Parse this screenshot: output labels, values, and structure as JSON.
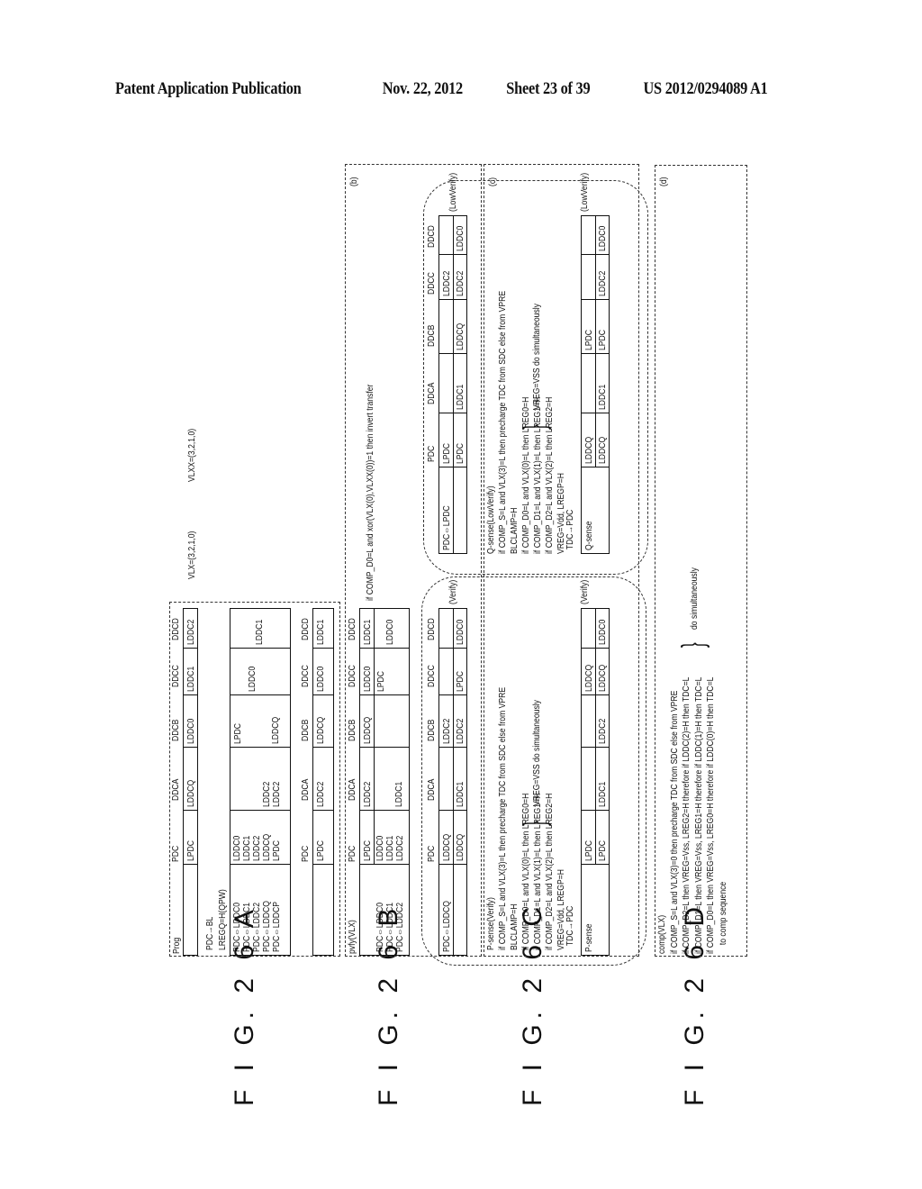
{
  "header": {
    "publication": "Patent Application Publication",
    "date": "Nov. 22, 2012",
    "sheet": "Sheet 23 of 39",
    "number": "US 2012/0294089 A1"
  },
  "figures": {
    "a": {
      "label": "F I G. 2 6 A",
      "vlx": "VLX=(3,2,1,0)",
      "vlxx": "VLXX=(3,2,1,0)",
      "columns": [
        "PDC",
        "DDCA",
        "DDCB",
        "DDCC",
        "DDCD"
      ],
      "table1": {
        "title": "Prog",
        "row": [
          "LPDC",
          "LDDCQ",
          "LDDC0",
          "LDDC1",
          "LDDC2"
        ]
      },
      "line1": "PDC→BL",
      "line2": "LREGQ=H(QPW)",
      "table2": {
        "ops": [
          "PDC⇔LDDC0",
          "PDC⇔LDDC1",
          "PDC⇔LDDC2",
          "PDC⇔LDDCQ",
          "PDC⇔LDDCP"
        ],
        "pdc": [
          "LDDC0",
          "LDDC1",
          "LDDC2",
          "LDDCQ",
          "LPDC"
        ],
        "ddca": [
          "LDDC2",
          "LDDC2"
        ],
        "ddcb_top": "LPDC",
        "ddcb_bottom": "LDDCQ",
        "ddcc": "LDDC0",
        "ddcd": "LDDC1"
      },
      "table3": {
        "row": [
          "LPDC",
          "LDDC2",
          "LDDCQ",
          "LDDC0",
          "LDDC1"
        ]
      }
    },
    "b": {
      "label": "F I G. 2 6 B",
      "tag": "(b)",
      "title": "pvfy(VLX)",
      "columns": [
        "PDC",
        "DDCA",
        "DDCB",
        "DDCC",
        "DDCD"
      ],
      "table1": {
        "header_row": [
          "LPDC",
          "LDDC2",
          "LDDCQ",
          "LDDC0",
          "LDDC1"
        ],
        "ops": [
          "PDC⇔LDDC0",
          "PDC⇔LDDC1",
          "PDC⇔LDDC2"
        ],
        "pdc": [
          "LDDC0",
          "LDDC1",
          "LDDC2"
        ],
        "ddca": "LDDC1",
        "ddcc": "LPDC",
        "ddcd": "LDDC0"
      },
      "condition": "if COMP_D0=L and xor(VLX(0),VLXX(0))=1 then invert transfer",
      "verify": {
        "op": "PDC⇔LDDCQ",
        "row1": [
          "LDDCQ",
          "",
          "LDDC2",
          "",
          ""
        ],
        "row2": [
          "LDDCQ",
          "LDDC1",
          "LDDC2",
          "LPDC",
          "LDDC0"
        ],
        "note": "(Verify)"
      },
      "lowverify": {
        "op": "PDC⇔LPDC",
        "row1": [
          "LPDC",
          "",
          "",
          "LDDC2",
          ""
        ],
        "row2": [
          "LPDC",
          "LDDC1",
          "LDDCQ",
          "LDDC2",
          "LDDC0"
        ],
        "note": "(LowVerify)"
      }
    },
    "c": {
      "label": "F I G. 2 6 C",
      "tag": "(c)",
      "psense": {
        "title": "P-sense(Verify)",
        "lines": [
          "if  COMP_S=L and VLX(3)=L then precharge TDC from SDC else from VPRE",
          "BLCLAMP=H",
          "if  COMP_D0=L and VLX(0)=L then LREG0=H",
          "if  COMP_D1=L and VLX(1)=L then LREG1=H",
          "if  COMP_D2=L and VLX(2)=L then LREG2=H",
          "VREG=Vdd, LREGP=H",
          "TDC→PDC"
        ],
        "brace_text": "VREG=VSS do simultaneously",
        "table_label": "P-sense",
        "row1": [
          "LPDC",
          "",
          "",
          "LDDCQ",
          ""
        ],
        "row2": [
          "LPDC",
          "LDDC1",
          "LDDC2",
          "LDDCQ",
          "LDDC0"
        ],
        "note": "(Verify)"
      },
      "qsense": {
        "title": "Q-sense(LowVerify)",
        "lines": [
          "if  COMP_S=L and VLX(3)=L then precharge TDC from SDC else from VPRE",
          "BLCLAMP=H",
          "if  COMP_D0=L and VLX(0)=L then LREG0=H",
          "if  COMP_D1=L and VLX(1)=L then LREG1=H",
          "if  COMP_D2=L and VLX(2)=L then LREG2=H",
          "VREG=Vdd, LREGP=H",
          "TDC→PDC"
        ],
        "brace_text": "VREG=VSS do simultaneously",
        "table_label": "Q-sense",
        "row1": [
          "LDDCQ",
          "",
          "LPDC",
          "",
          ""
        ],
        "row2": [
          "LDDCQ",
          "LDDC1",
          "LPDC",
          "LDDC2",
          "LDDC0"
        ],
        "note": "(LowVerify)"
      }
    },
    "d": {
      "label": "F I G. 2 6 D",
      "tag": "(d)",
      "title": "comp(VLX)",
      "lines": [
        "if  COMP_S=L and VLX(3)=0 then precharge TDC from SDC else from VPRE",
        "if  COMP_D2=L then VREG=Vss, LREG2=H therefore if LDDC(2)=H then TDC=L",
        "if  COMP_D1=L then VREG=Vss, LREG1=H therefore if LDDC(1)=H then TDC=L",
        "if  COMP_D0=L then VREG=Vss, LREG0=H therefore if LDDC(0)=H then TDC=L",
        "to comp sequence"
      ],
      "brace_text": "do simultaneously"
    }
  }
}
